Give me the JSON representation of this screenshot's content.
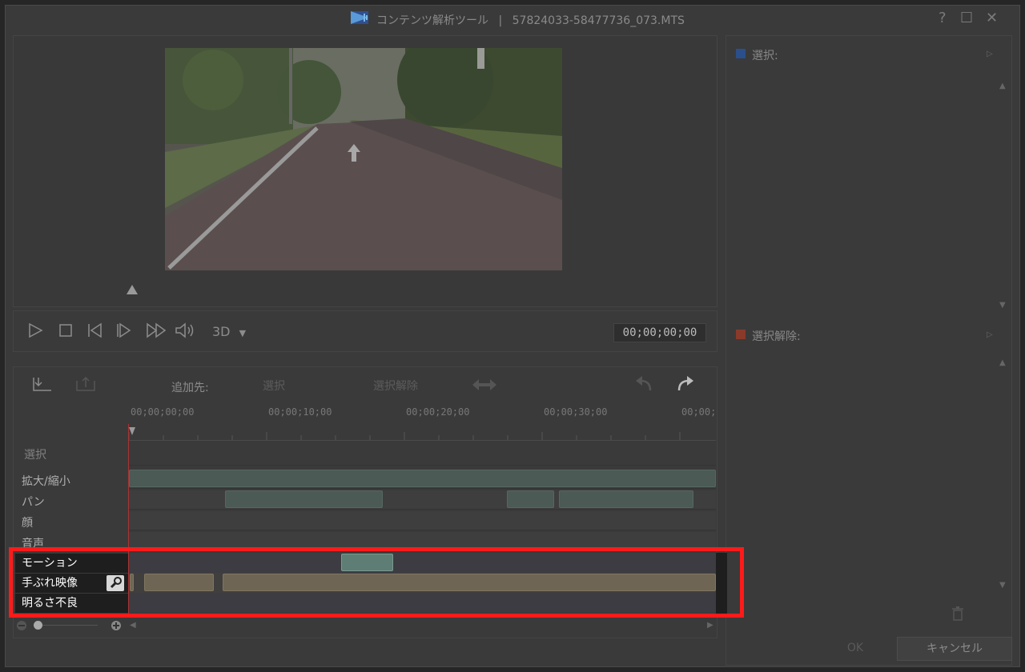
{
  "window": {
    "app_title": "コンテンツ解析ツール",
    "separator": "|",
    "file_name": "57824033-58477736_073.MTS",
    "help": "?",
    "maximize": "☐",
    "close": "✕"
  },
  "preview": {
    "timecode": "00;00;00;00",
    "mode_3d": "3D",
    "mode_caret": "▼"
  },
  "right_panel": {
    "select_label": "選択:",
    "deselect_label": "選択解除:",
    "select_color": "#2a4f8a",
    "deselect_color": "#8a3a2a"
  },
  "toolbar": {
    "add_to_label": "追加先:",
    "select_button": "選択",
    "deselect_button": "選択解除"
  },
  "timeline": {
    "ticks": [
      "00;00;00;00",
      "00;00;10;00",
      "00;00;20;00",
      "00;00;30;00",
      "00;00;"
    ],
    "tracks": [
      {
        "label": "選択"
      },
      {
        "label": "拡大/縮小"
      },
      {
        "label": "パン"
      },
      {
        "label": "顔"
      },
      {
        "label": "音声"
      },
      {
        "label": "モーション"
      },
      {
        "label": "手ぶれ映像"
      },
      {
        "label": "明るさ不良"
      }
    ]
  },
  "footer": {
    "ok": "OK",
    "cancel": "キャンセル"
  },
  "highlight_color": "#ff1a1a"
}
